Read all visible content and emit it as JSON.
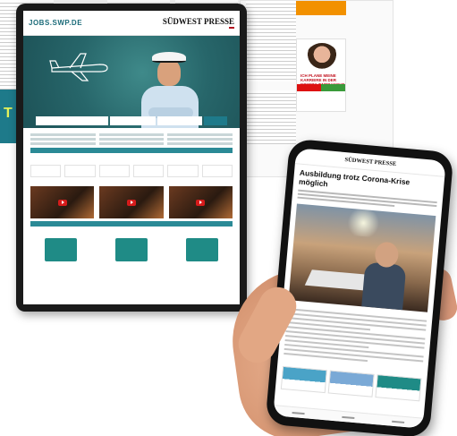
{
  "tablet": {
    "site_logo": "JOBS.SWP.DE",
    "brand_name": "SÜDWEST PRESSE",
    "brand_badge": "",
    "search_placeholders": [
      "",
      "",
      ""
    ],
    "search_button": "",
    "section_titles": [
      "",
      "",
      "",
      ""
    ],
    "bar_labels": [
      "",
      ""
    ],
    "logo_boxes": [
      "",
      "",
      "",
      "",
      "",
      ""
    ],
    "tile_labels": [
      "",
      "",
      ""
    ]
  },
  "newspaper_ad": {
    "headline": "ICH PLANE MEINE KARRIERE IN DER IMMOBILIENBRANCHE",
    "teal_text": "T"
  },
  "phone": {
    "brand_name": "SÜDWEST PRESSE",
    "kicker": "",
    "title": "Ausbildung trotz Corona-Krise möglich",
    "related_heading": ""
  },
  "colors": {
    "teal": "#1e7a8a",
    "brand_red": "#b3121f",
    "hero": "#27666a"
  }
}
